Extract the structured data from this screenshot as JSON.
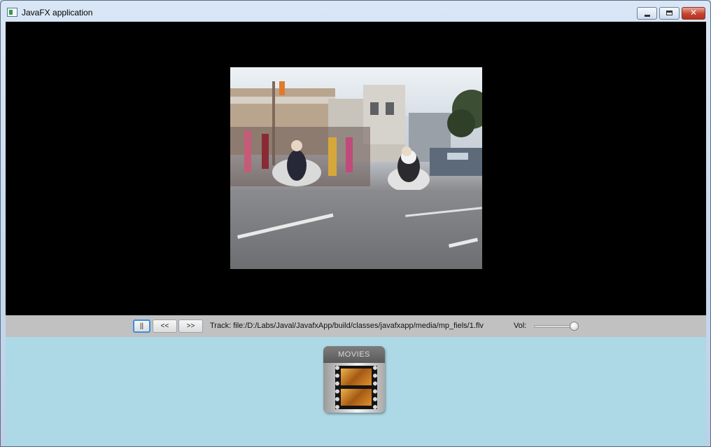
{
  "window": {
    "title": "JavaFX application",
    "icon": "app-icon",
    "controls": [
      "minimize-icon",
      "maximize-icon",
      "close-icon"
    ]
  },
  "video": {
    "description_icon": "video-frame",
    "background_color": "#000000"
  },
  "controls": {
    "pause_label": "||",
    "back_label": "<<",
    "forward_label": ">>",
    "track_text": "Track: file:/D:/Labs/Javal/JavafxApp/build/classes/javafxapp/media/mp_fiels/1.flv",
    "volume_label": "Vol:",
    "volume_level": 0.9
  },
  "movies_icon": {
    "label": "MOVIES",
    "icon": "film-icon"
  },
  "colors": {
    "content_background": "#add8e6",
    "control_bar": "#c1c1c1",
    "focus_accent": "#3c8ede"
  }
}
